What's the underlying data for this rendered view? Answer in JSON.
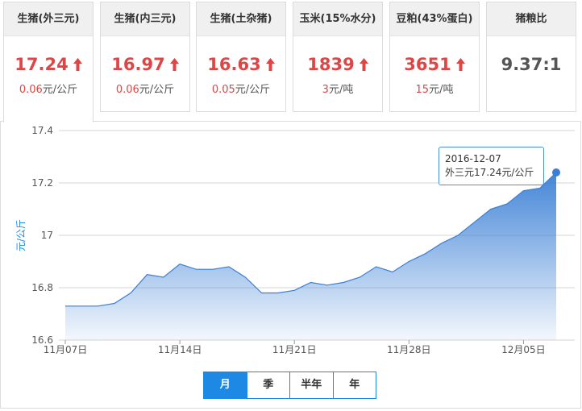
{
  "cards": [
    {
      "title": "生猪(外三元)",
      "price": "17.24",
      "change": "0.06",
      "unit": "元/公斤",
      "trend": "up"
    },
    {
      "title": "生猪(内三元)",
      "price": "16.97",
      "change": "0.06",
      "unit": "元/公斤",
      "trend": "up"
    },
    {
      "title": "生猪(土杂猪)",
      "price": "16.63",
      "change": "0.05",
      "unit": "元/公斤",
      "trend": "up"
    },
    {
      "title": "玉米(15%水分)",
      "price": "1839",
      "change": "3",
      "unit": "元/吨",
      "trend": "up"
    },
    {
      "title": "豆粕(43%蛋白)",
      "price": "3651",
      "change": "15",
      "unit": "元/吨",
      "trend": "up"
    },
    {
      "title": "猪粮比",
      "ratio": "9.37:1"
    }
  ],
  "colors": {
    "accent": "#1e88e5",
    "up": "#e04545",
    "series": "#3a7fd5"
  },
  "tabs": [
    {
      "label": "月",
      "active": true
    },
    {
      "label": "季",
      "active": false
    },
    {
      "label": "半年",
      "active": false
    },
    {
      "label": "年",
      "active": false
    }
  ],
  "tooltip": {
    "date": "2016-12-07",
    "text": "外三元17.24元/公斤"
  },
  "chart_data": {
    "type": "area",
    "title": "",
    "xlabel": "",
    "ylabel": "元/公斤",
    "ylim": [
      16.6,
      17.4
    ],
    "yticks": [
      16.6,
      16.8,
      17,
      17.2,
      17.4
    ],
    "grid": true,
    "x": [
      "2016-11-07",
      "2016-11-08",
      "2016-11-09",
      "2016-11-10",
      "2016-11-11",
      "2016-11-12",
      "2016-11-13",
      "2016-11-14",
      "2016-11-15",
      "2016-11-16",
      "2016-11-17",
      "2016-11-18",
      "2016-11-19",
      "2016-11-20",
      "2016-11-21",
      "2016-11-22",
      "2016-11-23",
      "2016-11-24",
      "2016-11-25",
      "2016-11-26",
      "2016-11-27",
      "2016-11-28",
      "2016-11-29",
      "2016-11-30",
      "2016-12-01",
      "2016-12-02",
      "2016-12-03",
      "2016-12-04",
      "2016-12-05",
      "2016-12-06",
      "2016-12-07"
    ],
    "xticks": [
      {
        "date": "2016-11-07",
        "label": "11月07日"
      },
      {
        "date": "2016-11-14",
        "label": "11月14日"
      },
      {
        "date": "2016-11-21",
        "label": "11月21日"
      },
      {
        "date": "2016-11-28",
        "label": "11月28日"
      },
      {
        "date": "2016-12-05",
        "label": "12月05日"
      }
    ],
    "series": [
      {
        "values": [
          16.73,
          16.73,
          16.73,
          16.74,
          16.78,
          16.85,
          16.84,
          16.89,
          16.87,
          16.87,
          16.88,
          16.84,
          16.78,
          16.78,
          16.79,
          16.82,
          16.81,
          16.82,
          16.84,
          16.88,
          16.86,
          16.9,
          16.93,
          16.97,
          17.0,
          17.05,
          17.1,
          17.12,
          17.17,
          17.18,
          17.24
        ]
      }
    ]
  }
}
